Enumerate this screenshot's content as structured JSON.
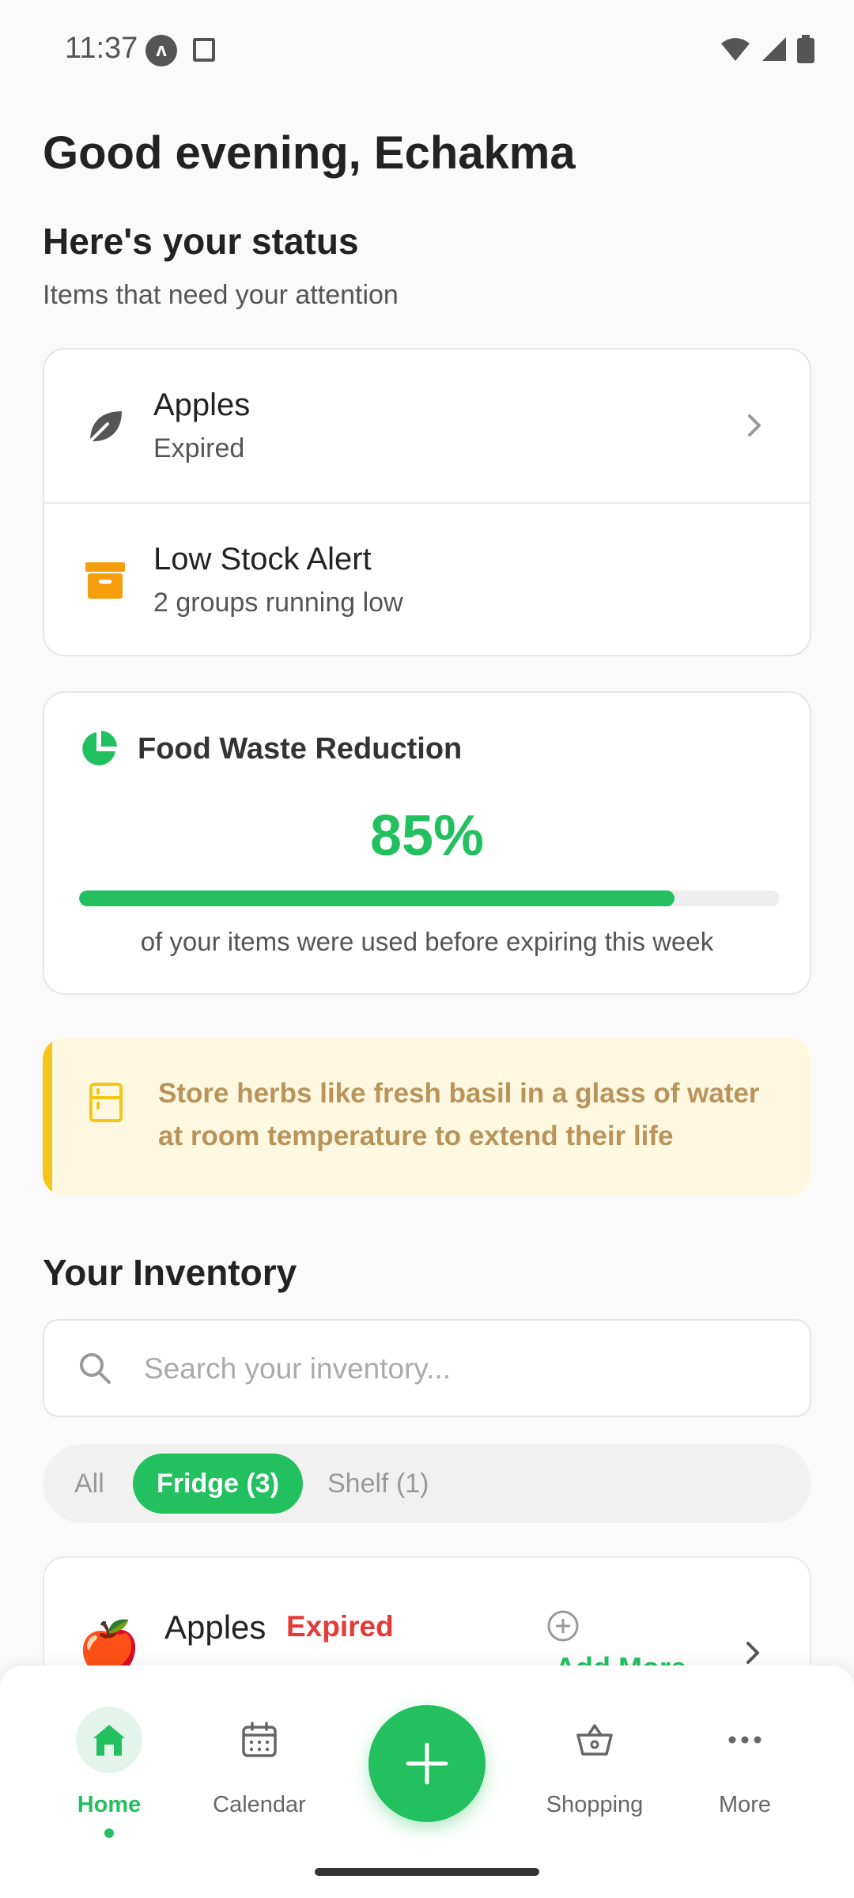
{
  "status_bar": {
    "time": "11:37",
    "app_icon_letter": "ʌ"
  },
  "greeting": "Good evening, Echakma",
  "status": {
    "heading": "Here's your status",
    "subheading": "Items that need your attention"
  },
  "alerts": [
    {
      "title": "Apples",
      "subtitle": "Expired",
      "icon": "leaf-icon",
      "icon_color": "#555555"
    },
    {
      "title": "Low Stock Alert",
      "subtitle": "2 groups running low",
      "icon": "archive-box-icon",
      "icon_color": "#f59e0b"
    }
  ],
  "waste": {
    "title": "Food Waste Reduction",
    "percent_label": "85%",
    "percent_value": 0.85,
    "caption": "of your items were used before expiring this week"
  },
  "tip": {
    "text": "Store herbs like fresh basil in a glass of water at room temperature to extend their life",
    "icon": "fridge-icon"
  },
  "inventory": {
    "heading": "Your Inventory",
    "search_placeholder": "Search your inventory...",
    "search_value": "",
    "filters": [
      "All",
      "Fridge (3)",
      "Shelf (1)"
    ],
    "active_filter": "Fridge (3)",
    "items": [
      {
        "emoji": "🍎",
        "name": "Apples",
        "badge": "Expired",
        "add_label": "Add More"
      }
    ]
  },
  "nav": {
    "items": [
      {
        "label": "Home",
        "icon": "home-icon",
        "active": true
      },
      {
        "label": "Calendar",
        "icon": "calendar-icon",
        "active": false
      },
      {
        "label": "Shopping",
        "icon": "shopping-basket-icon",
        "active": false
      },
      {
        "label": "More",
        "icon": "more-dots-icon",
        "active": false
      }
    ],
    "fab_icon": "plus-icon"
  },
  "colors": {
    "accent": "#22c05e",
    "danger": "#e53935",
    "warning": "#f59e0b",
    "tip_bg": "#fff8e1",
    "tip_text": "#b8935a"
  }
}
